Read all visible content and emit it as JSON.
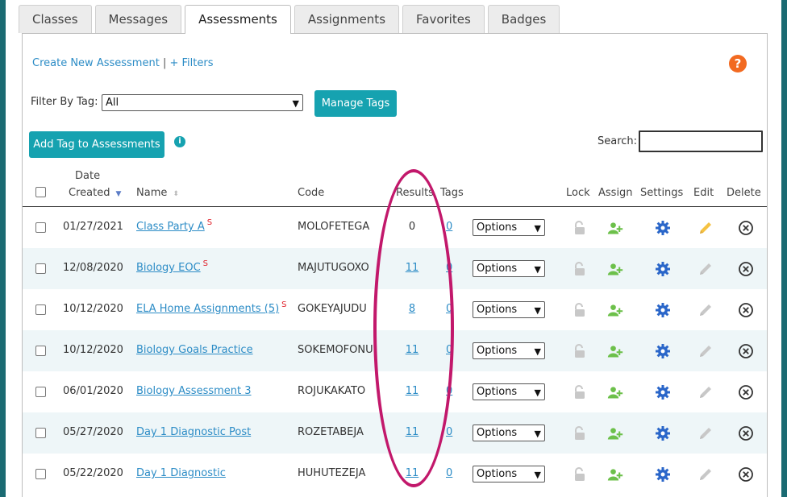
{
  "tabs": [
    "Classes",
    "Messages",
    "Assessments",
    "Assignments",
    "Favorites",
    "Badges"
  ],
  "active_tab": "Assessments",
  "links": {
    "create": "Create New Assessment",
    "sep": "|",
    "filters": "+ Filters"
  },
  "help": "?",
  "filter": {
    "label": "Filter By Tag:",
    "value": "All"
  },
  "buttons": {
    "manage_tags": "Manage Tags",
    "add_tag": "Add Tag to Assessments"
  },
  "info": "i",
  "search": {
    "label": "Search:",
    "value": ""
  },
  "headers": {
    "date_created_1": "Date",
    "date_created_2": "Created",
    "name": "Name",
    "code": "Code",
    "results": "Results",
    "tags": "Tags",
    "lock": "Lock",
    "assign": "Assign",
    "settings": "Settings",
    "edit": "Edit",
    "delete": "Delete"
  },
  "options_label": "Options",
  "rows": [
    {
      "date": "01/27/2021",
      "name": "Class Party A",
      "s": "S",
      "code": "MOLOFETEGA",
      "results": "0",
      "results_link": false,
      "tags": "0",
      "edit_active": true
    },
    {
      "date": "12/08/2020",
      "name": "Biology EOC",
      "s": "S",
      "code": "MAJUTUGOXO",
      "results": "11",
      "results_link": true,
      "tags": "0",
      "edit_active": false
    },
    {
      "date": "10/12/2020",
      "name": "ELA Home Assignments (5)",
      "s": "S",
      "code": "GOKEYAJUDU",
      "results": "8",
      "results_link": true,
      "tags": "0",
      "edit_active": false
    },
    {
      "date": "10/12/2020",
      "name": "Biology Goals Practice",
      "s": "",
      "code": "SOKEMOFONU",
      "results": "11",
      "results_link": true,
      "tags": "0",
      "edit_active": false
    },
    {
      "date": "06/01/2020",
      "name": "Biology Assessment 3",
      "s": "",
      "code": "ROJUKAKATO",
      "results": "11",
      "results_link": true,
      "tags": "0",
      "edit_active": false
    },
    {
      "date": "05/27/2020",
      "name": "Day 1 Diagnostic Post",
      "s": "",
      "code": "ROZETABEJA",
      "results": "11",
      "results_link": true,
      "tags": "0",
      "edit_active": false
    },
    {
      "date": "05/22/2020",
      "name": "Day 1 Diagnostic",
      "s": "",
      "code": "HUHUTEZEJA",
      "results": "11",
      "results_link": true,
      "tags": "0",
      "edit_active": false
    }
  ],
  "colors": {
    "teal": "#16a2b0",
    "link": "#2c8cc6",
    "annotation": "#c2186b",
    "assign_green": "#6cc04a",
    "settings_blue": "#2a66c9",
    "edit_yellow": "#f5c242"
  }
}
